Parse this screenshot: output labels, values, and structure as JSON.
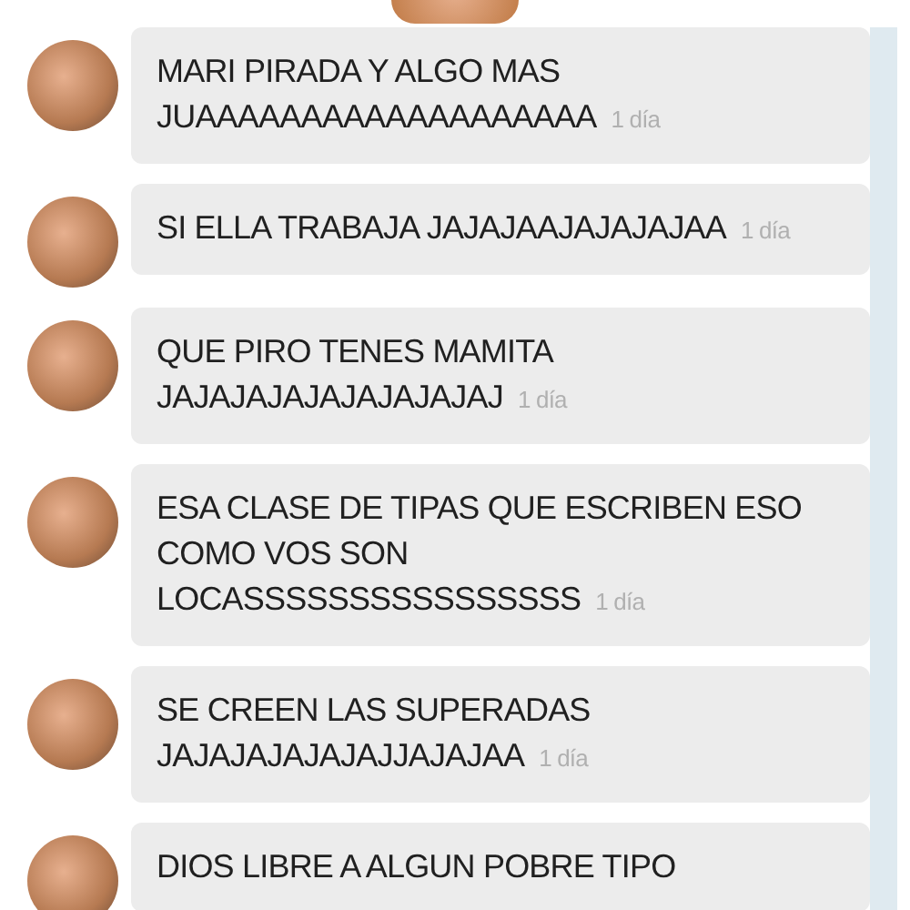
{
  "messages": [
    {
      "text": "MARI PIRADA Y ALGO MAS JUAAAAAAAAAAAAAAAAAAA",
      "time": "1 día"
    },
    {
      "text": "SI ELLA TRABAJA JAJAJAAJAJAJAJAA",
      "time": "1 día"
    },
    {
      "text": "QUE PIRO TENES MAMITA JAJAJAJAJAJAJAJAJAJ",
      "time": "1 día"
    },
    {
      "text": "ESA CLASE DE TIPAS QUE ESCRIBEN ESO COMO VOS SON LOCASSSSSSSSSSSSSSSS",
      "time": "1 día"
    },
    {
      "text": "SE CREEN LAS SUPERADAS JAJAJAJAJAJAJJAJAJAA",
      "time": "1 día"
    },
    {
      "text": "DIOS LIBRE A ALGUN POBRE TIPO"
    }
  ]
}
